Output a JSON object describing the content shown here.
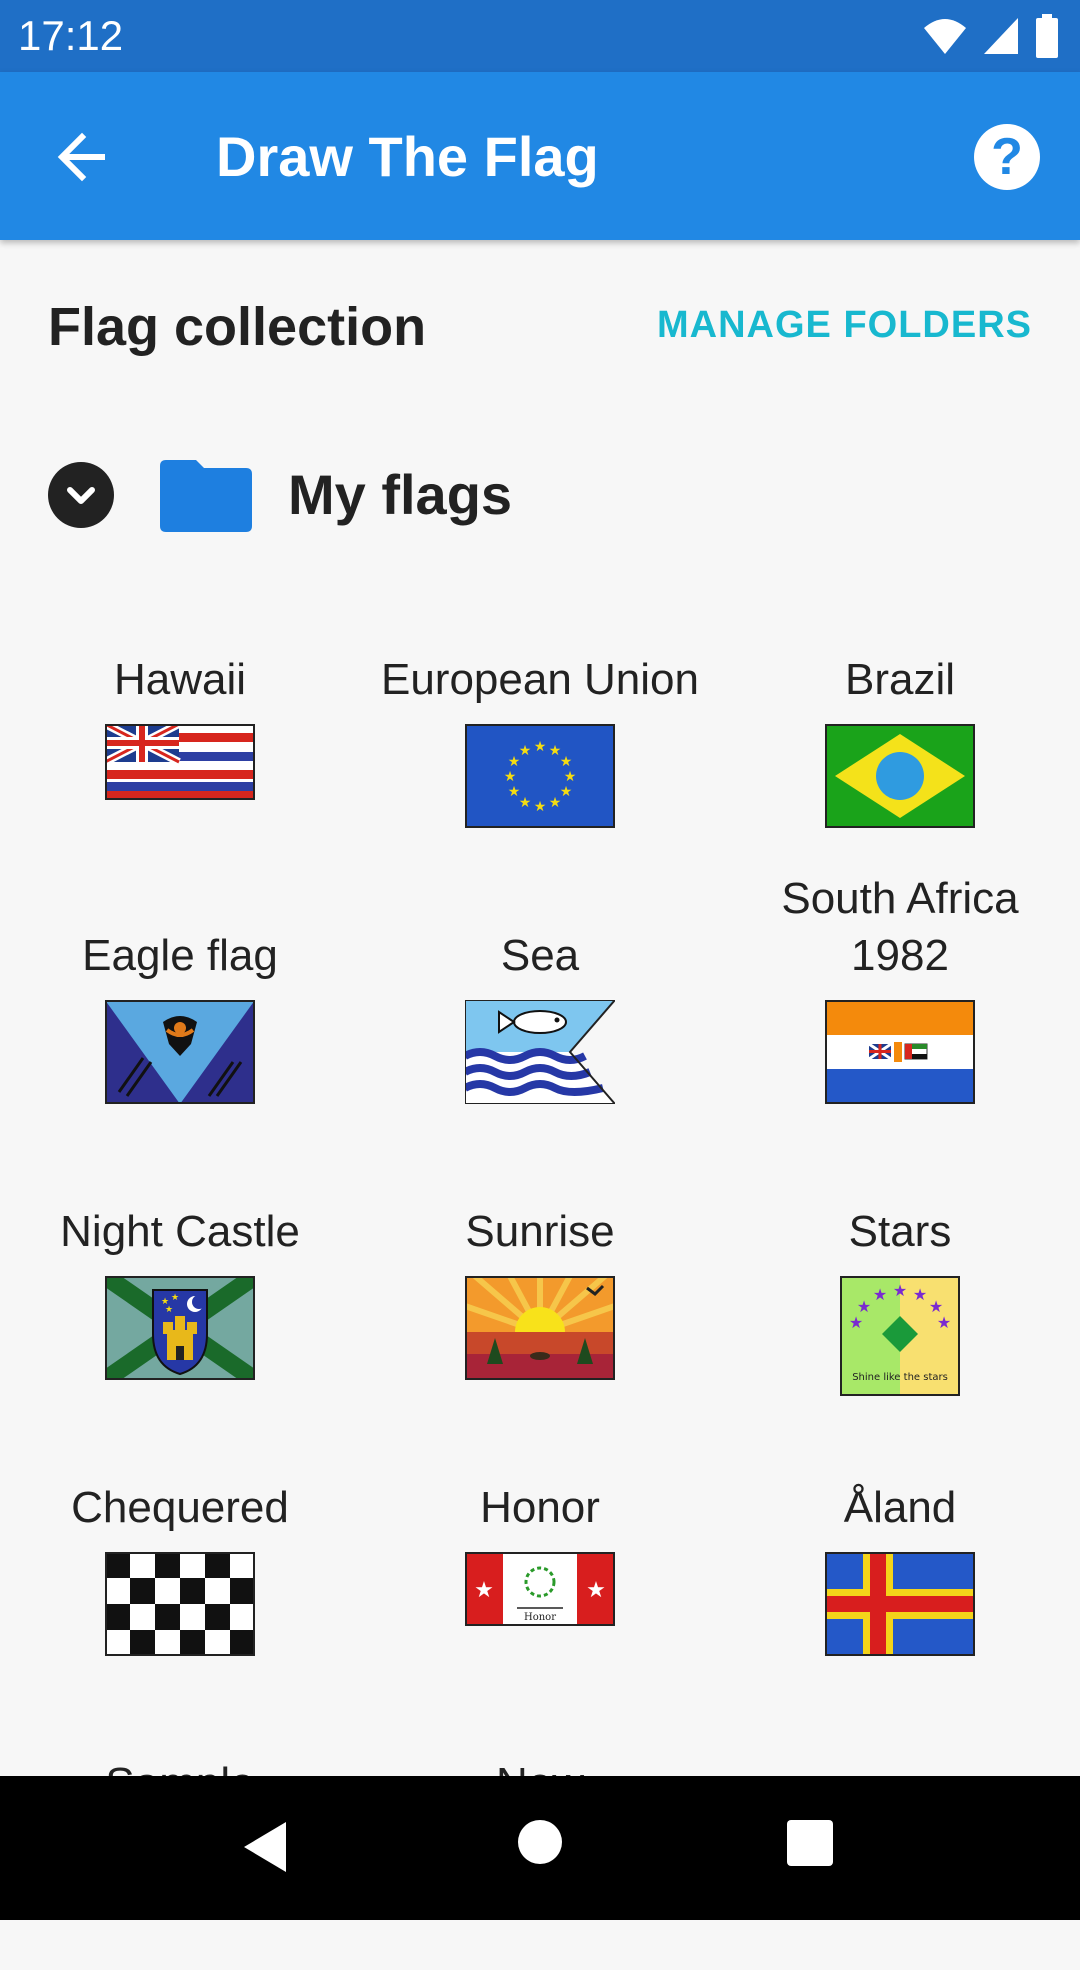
{
  "status": {
    "time": "17:12"
  },
  "appbar": {
    "title": "Draw The Flag",
    "help": "?"
  },
  "section": {
    "title": "Flag collection",
    "manage": "MANAGE FOLDERS"
  },
  "folder": {
    "name": "My flags",
    "color": "#1e7fe0"
  },
  "flags": [
    {
      "name": "Hawaii",
      "icon": "hawaii-flag"
    },
    {
      "name": "European Union",
      "icon": "eu-flag"
    },
    {
      "name": "Brazil",
      "icon": "brazil-flag"
    },
    {
      "name": "Eagle flag",
      "icon": "eagle-flag"
    },
    {
      "name": "Sea",
      "icon": "sea-flag"
    },
    {
      "name": "South Africa 1982",
      "icon": "south-africa-flag"
    },
    {
      "name": "Night Castle",
      "icon": "night-castle-flag"
    },
    {
      "name": "Sunrise",
      "icon": "sunrise-flag"
    },
    {
      "name": "Stars",
      "icon": "stars-flag",
      "motto": "Shine like the stars"
    },
    {
      "name": "Chequered",
      "icon": "chequered-flag"
    },
    {
      "name": "Honor",
      "icon": "honor-flag",
      "motto": "Honor"
    },
    {
      "name": "Åland",
      "icon": "aland-flag"
    },
    {
      "name": "Sample",
      "icon": "partial"
    },
    {
      "name": "New",
      "icon": "partial"
    }
  ]
}
